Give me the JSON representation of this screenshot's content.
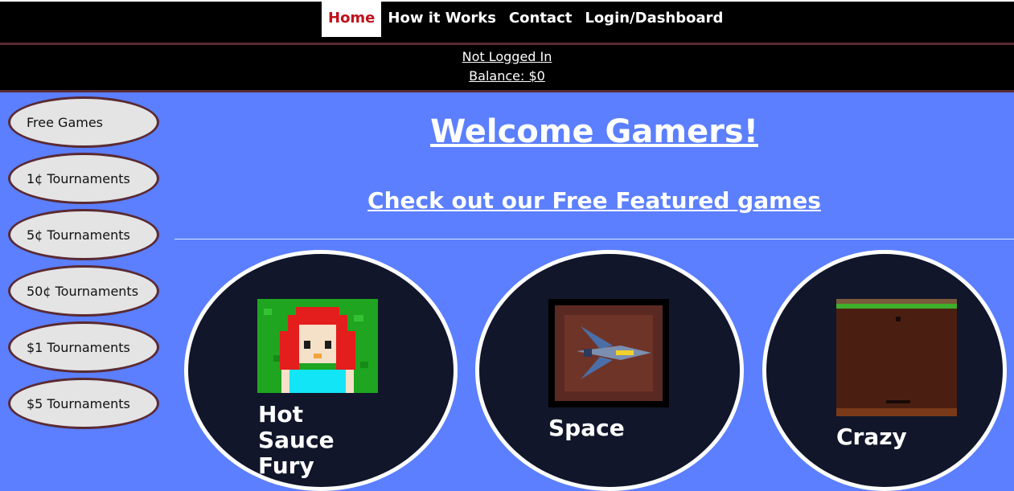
{
  "nav": {
    "items": [
      {
        "label": "Home",
        "active": true
      },
      {
        "label": "How it Works"
      },
      {
        "label": "Contact"
      },
      {
        "label": "Login/Dashboard"
      }
    ]
  },
  "status": {
    "login": "Not Logged In",
    "balance": "Balance: $0"
  },
  "sidebar": {
    "items": [
      {
        "label": "Free Games"
      },
      {
        "label": "1¢ Tournaments"
      },
      {
        "label": "5¢ Tournaments"
      },
      {
        "label": "50¢ Tournaments"
      },
      {
        "label": "$1 Tournaments"
      },
      {
        "label": "$5 Tournaments"
      }
    ]
  },
  "main": {
    "welcome": "Welcome Gamers!",
    "featured": "Check out our Free Featured games"
  },
  "games": [
    {
      "title": "Hot Sauce Fury",
      "image": "girl-pixel-art-thumbnail"
    },
    {
      "title": "Space",
      "image": "spaceship-thumbnail"
    },
    {
      "title": "Crazy",
      "image": "platform-level-thumbnail"
    }
  ],
  "colors": {
    "background": "#5b7ffe",
    "nav": "#000000",
    "active": "#c0121c",
    "card": "#11162a"
  }
}
